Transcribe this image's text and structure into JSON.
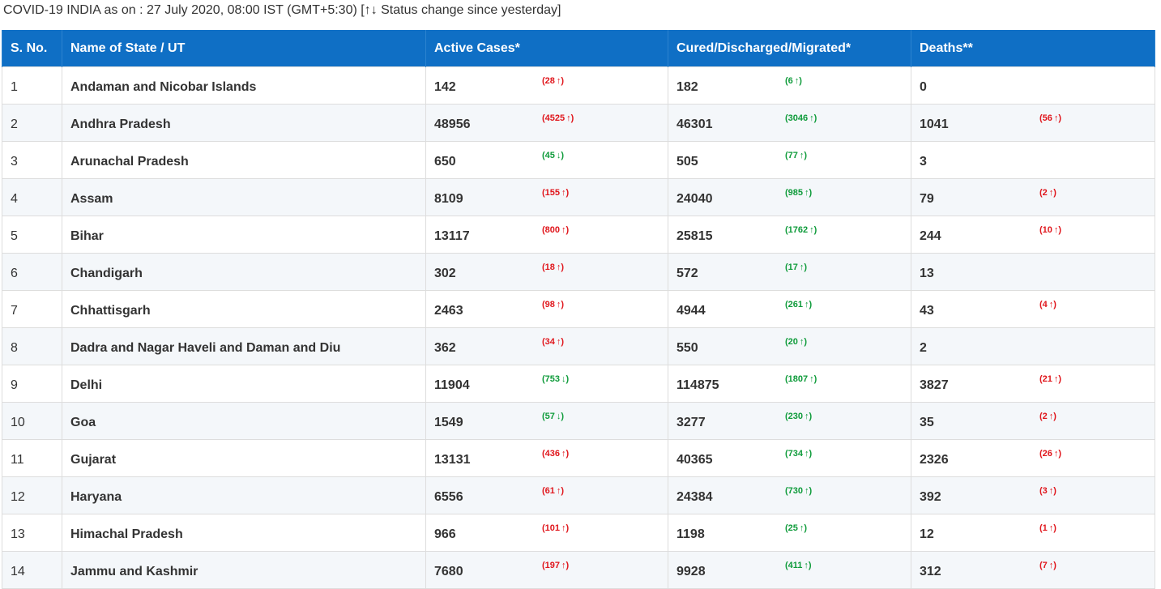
{
  "status_line": "COVID-19 INDIA as on : 27 July 2020, 08:00 IST (GMT+5:30) [↑↓ Status change since yesterday]",
  "columns": [
    "S. No.",
    "Name of State / UT",
    "Active Cases*",
    "Cured/Discharged/Migrated*",
    "Deaths**"
  ],
  "colors": {
    "header_bg": "#0f6fc5",
    "increase_red": "#e0161c",
    "decrease_green": "#0e9b3a"
  },
  "rows": [
    {
      "sno": "1",
      "name": "Andaman and Nicobar Islands",
      "active": "142",
      "active_change": {
        "value": "28",
        "dir": "up",
        "color": "red"
      },
      "cured": "182",
      "cured_change": {
        "value": "6",
        "dir": "up",
        "color": "green"
      },
      "deaths": "0",
      "deaths_change": null
    },
    {
      "sno": "2",
      "name": "Andhra Pradesh",
      "active": "48956",
      "active_change": {
        "value": "4525",
        "dir": "up",
        "color": "red"
      },
      "cured": "46301",
      "cured_change": {
        "value": "3046",
        "dir": "up",
        "color": "green"
      },
      "deaths": "1041",
      "deaths_change": {
        "value": "56",
        "dir": "up",
        "color": "red"
      }
    },
    {
      "sno": "3",
      "name": "Arunachal Pradesh",
      "active": "650",
      "active_change": {
        "value": "45",
        "dir": "down",
        "color": "green"
      },
      "cured": "505",
      "cured_change": {
        "value": "77",
        "dir": "up",
        "color": "green"
      },
      "deaths": "3",
      "deaths_change": null
    },
    {
      "sno": "4",
      "name": "Assam",
      "active": "8109",
      "active_change": {
        "value": "155",
        "dir": "up",
        "color": "red"
      },
      "cured": "24040",
      "cured_change": {
        "value": "985",
        "dir": "up",
        "color": "green"
      },
      "deaths": "79",
      "deaths_change": {
        "value": "2",
        "dir": "up",
        "color": "red"
      }
    },
    {
      "sno": "5",
      "name": "Bihar",
      "active": "13117",
      "active_change": {
        "value": "800",
        "dir": "up",
        "color": "red"
      },
      "cured": "25815",
      "cured_change": {
        "value": "1762",
        "dir": "up",
        "color": "green"
      },
      "deaths": "244",
      "deaths_change": {
        "value": "10",
        "dir": "up",
        "color": "red"
      }
    },
    {
      "sno": "6",
      "name": "Chandigarh",
      "active": "302",
      "active_change": {
        "value": "18",
        "dir": "up",
        "color": "red"
      },
      "cured": "572",
      "cured_change": {
        "value": "17",
        "dir": "up",
        "color": "green"
      },
      "deaths": "13",
      "deaths_change": null
    },
    {
      "sno": "7",
      "name": "Chhattisgarh",
      "active": "2463",
      "active_change": {
        "value": "98",
        "dir": "up",
        "color": "red"
      },
      "cured": "4944",
      "cured_change": {
        "value": "261",
        "dir": "up",
        "color": "green"
      },
      "deaths": "43",
      "deaths_change": {
        "value": "4",
        "dir": "up",
        "color": "red"
      }
    },
    {
      "sno": "8",
      "name": "Dadra and Nagar Haveli and Daman and Diu",
      "active": "362",
      "active_change": {
        "value": "34",
        "dir": "up",
        "color": "red"
      },
      "cured": "550",
      "cured_change": {
        "value": "20",
        "dir": "up",
        "color": "green"
      },
      "deaths": "2",
      "deaths_change": null
    },
    {
      "sno": "9",
      "name": "Delhi",
      "active": "11904",
      "active_change": {
        "value": "753",
        "dir": "down",
        "color": "green"
      },
      "cured": "114875",
      "cured_change": {
        "value": "1807",
        "dir": "up",
        "color": "green"
      },
      "deaths": "3827",
      "deaths_change": {
        "value": "21",
        "dir": "up",
        "color": "red"
      }
    },
    {
      "sno": "10",
      "name": "Goa",
      "active": "1549",
      "active_change": {
        "value": "57",
        "dir": "down",
        "color": "green"
      },
      "cured": "3277",
      "cured_change": {
        "value": "230",
        "dir": "up",
        "color": "green"
      },
      "deaths": "35",
      "deaths_change": {
        "value": "2",
        "dir": "up",
        "color": "red"
      }
    },
    {
      "sno": "11",
      "name": "Gujarat",
      "active": "13131",
      "active_change": {
        "value": "436",
        "dir": "up",
        "color": "red"
      },
      "cured": "40365",
      "cured_change": {
        "value": "734",
        "dir": "up",
        "color": "green"
      },
      "deaths": "2326",
      "deaths_change": {
        "value": "26",
        "dir": "up",
        "color": "red"
      }
    },
    {
      "sno": "12",
      "name": "Haryana",
      "active": "6556",
      "active_change": {
        "value": "61",
        "dir": "up",
        "color": "red"
      },
      "cured": "24384",
      "cured_change": {
        "value": "730",
        "dir": "up",
        "color": "green"
      },
      "deaths": "392",
      "deaths_change": {
        "value": "3",
        "dir": "up",
        "color": "red"
      }
    },
    {
      "sno": "13",
      "name": "Himachal Pradesh",
      "active": "966",
      "active_change": {
        "value": "101",
        "dir": "up",
        "color": "red"
      },
      "cured": "1198",
      "cured_change": {
        "value": "25",
        "dir": "up",
        "color": "green"
      },
      "deaths": "12",
      "deaths_change": {
        "value": "1",
        "dir": "up",
        "color": "red"
      }
    },
    {
      "sno": "14",
      "name": "Jammu and Kashmir",
      "active": "7680",
      "active_change": {
        "value": "197",
        "dir": "up",
        "color": "red"
      },
      "cured": "9928",
      "cured_change": {
        "value": "411",
        "dir": "up",
        "color": "green"
      },
      "deaths": "312",
      "deaths_change": {
        "value": "7",
        "dir": "up",
        "color": "red"
      }
    }
  ]
}
